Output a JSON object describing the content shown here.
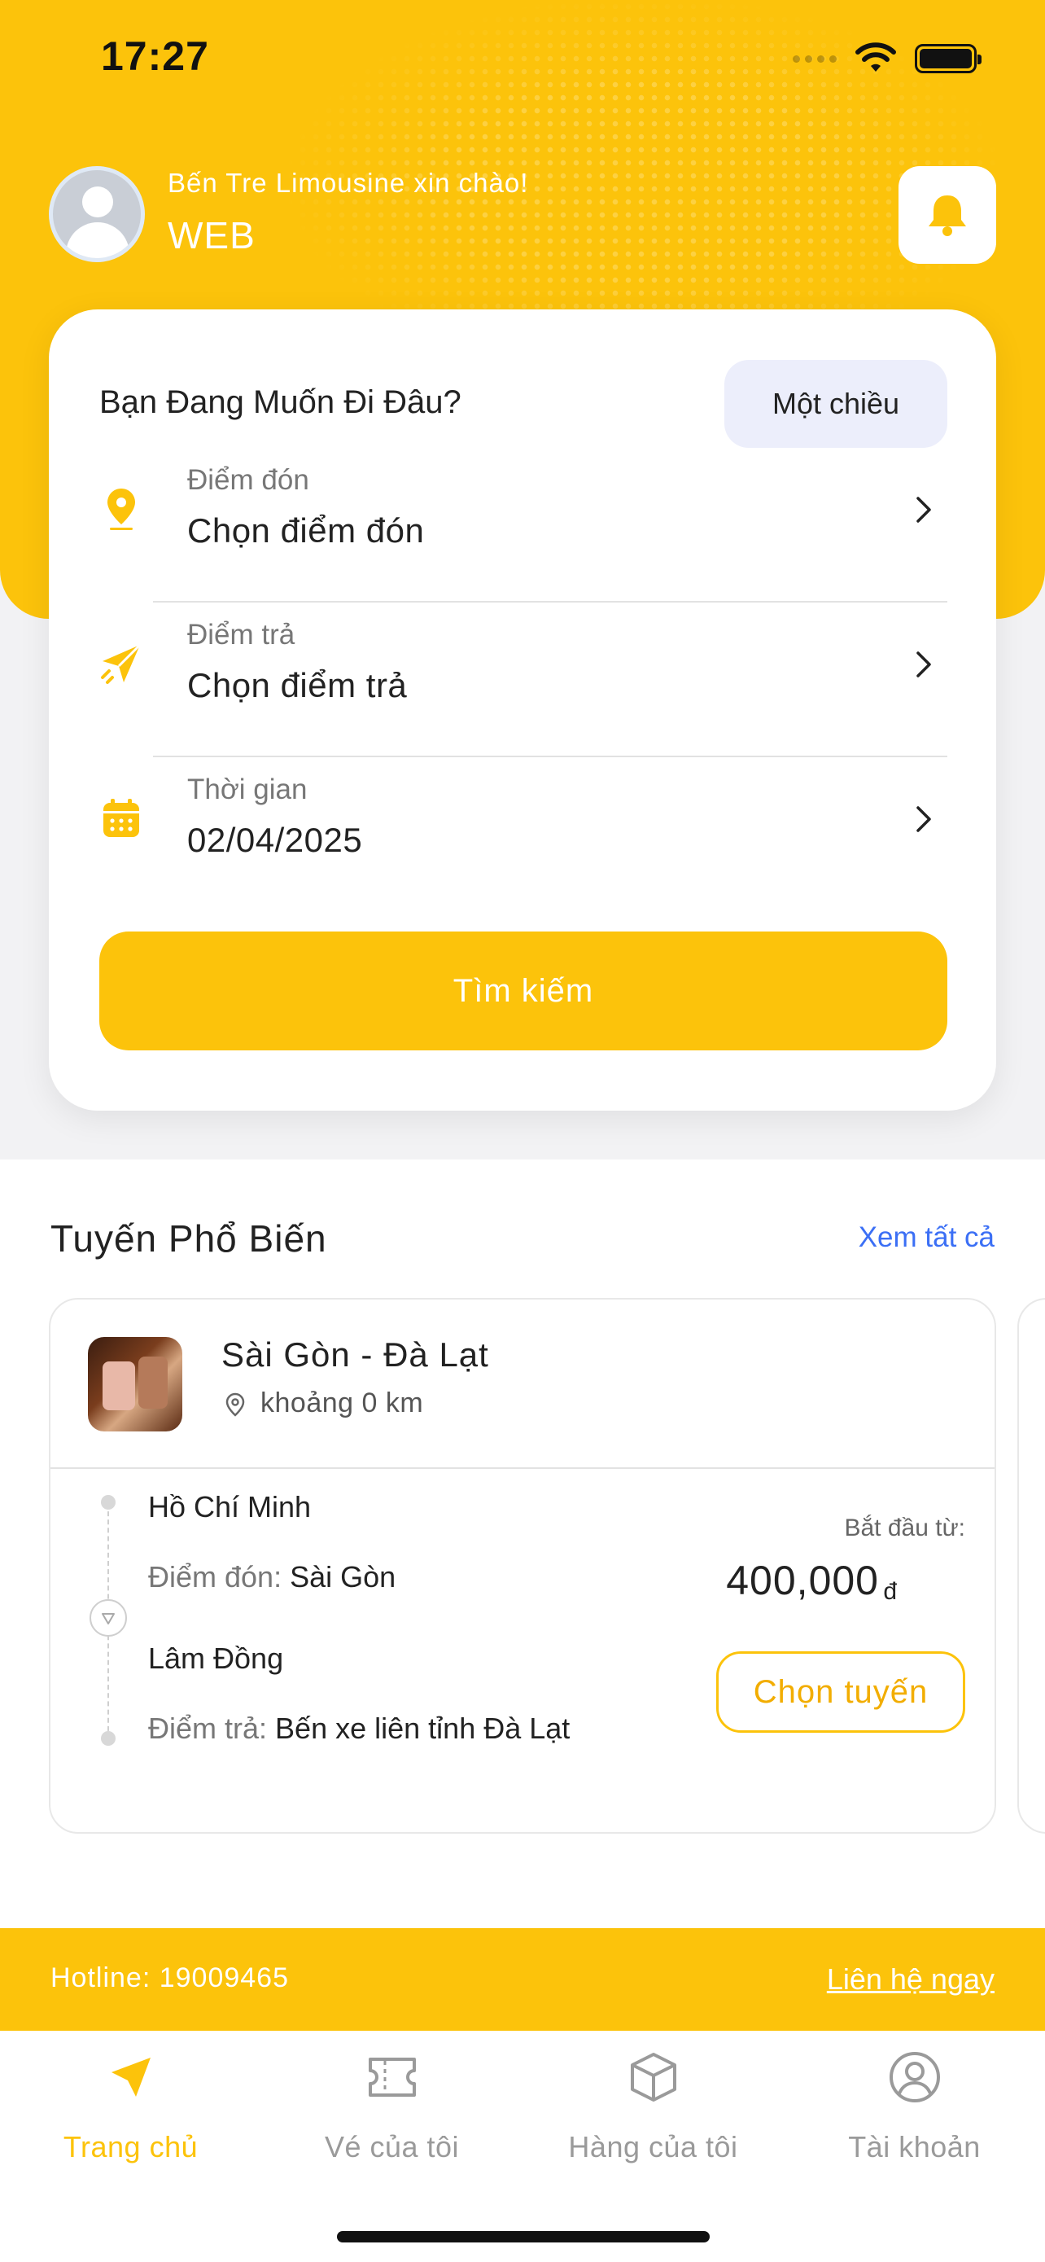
{
  "status_bar": {
    "time": "17:27"
  },
  "header": {
    "greeting": "Bến Tre Limousine xin chào!",
    "username": "WEB"
  },
  "search": {
    "title": "Bạn Đang Muốn Đi Đâu?",
    "trip_type": "Một chiều",
    "pickup": {
      "label": "Điểm đón",
      "value": "Chọn điểm đón"
    },
    "dropoff": {
      "label": "Điểm trả",
      "value": "Chọn điểm trả"
    },
    "date": {
      "label": "Thời gian",
      "value": "02/04/2025"
    },
    "search_button": "Tìm kiếm"
  },
  "popular": {
    "title": "Tuyến Phổ Biến",
    "see_all": "Xem tất cả",
    "routes": [
      {
        "name": "Sài Gòn - Đà Lạt",
        "distance": "khoảng 0 km",
        "from_city": "Hồ Chí Minh",
        "pickup_label": "Điểm đón:",
        "pickup": "Sài Gòn",
        "to_city": "Lâm Đồng",
        "dropoff_label": "Điểm trả:",
        "dropoff": "Bến xe liên tỉnh Đà Lạt",
        "price_label": "Bắt đầu từ:",
        "price": "400,000",
        "currency": "đ",
        "choose": "Chọn tuyến"
      }
    ]
  },
  "footer": {
    "hotline": "Hotline: 19009465",
    "contact": "Liên hệ ngay"
  },
  "tabs": [
    {
      "label": "Trang chủ",
      "icon": "send-icon",
      "active": true
    },
    {
      "label": "Vé của tôi",
      "icon": "ticket-icon",
      "active": false
    },
    {
      "label": "Hàng của tôi",
      "icon": "box-icon",
      "active": false
    },
    {
      "label": "Tài khoản",
      "icon": "user-circle-icon",
      "active": false
    }
  ],
  "colors": {
    "accent": "#fcc30b",
    "link": "#3b6ff5"
  }
}
